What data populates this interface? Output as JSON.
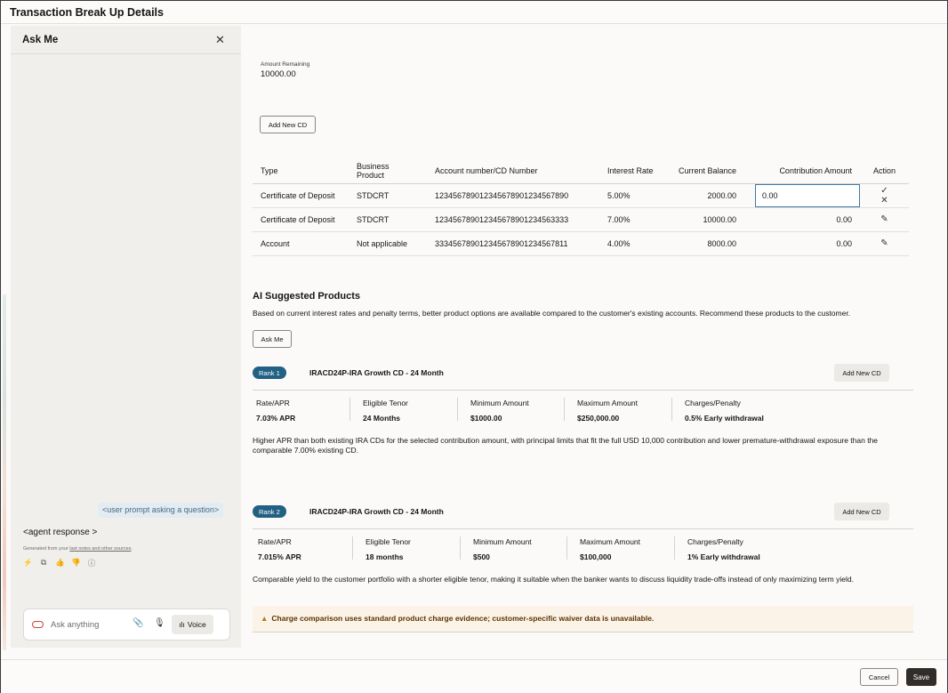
{
  "window": {
    "title": "Transaction Break Up Details"
  },
  "ask_panel": {
    "title": "Ask Me",
    "user_prompt": "<user prompt asking a question>",
    "agent_response": "<agent response >",
    "generated_prefix": "Generated from your ",
    "generated_link": "last notes and other sources",
    "generated_suffix": ".",
    "input_placeholder": "Ask anything",
    "voice_label": "Voice"
  },
  "amount": {
    "label": "Amount Remaining",
    "value": "10000.00"
  },
  "add_new_cd_label": "Add New CD",
  "table": {
    "headers": [
      "Type",
      "Business Product",
      "Account number/CD Number",
      "Interest Rate",
      "Current Balance",
      "Contribution Amount",
      "Action"
    ],
    "rows": [
      {
        "type": "Certificate of Deposit",
        "product": "STDCRT",
        "account": "123456789012345678901234567890",
        "rate": "5.00%",
        "balance": "2000.00",
        "contribution": "0.00",
        "editing": true
      },
      {
        "type": "Certificate of Deposit",
        "product": "STDCRT",
        "account": "123456789012345678901234563333",
        "rate": "7.00%",
        "balance": "10000.00",
        "contribution": "0.00",
        "editing": false
      },
      {
        "type": "Account",
        "product": "Not applicable",
        "account": "333456789012345678901234567811",
        "rate": "4.00%",
        "balance": "8000.00",
        "contribution": "0.00",
        "editing": false
      }
    ]
  },
  "ai": {
    "title": "AI Suggested Products",
    "description": "Based on current interest rates and penalty terms, better product options are available compared to the customer's existing accounts. Recommend these products to the customer.",
    "ask_me_label": "Ask Me",
    "products": [
      {
        "rank": "Rank 1",
        "name": "IRACD24P-IRA Growth CD - 24 Month",
        "add_label": "Add New CD",
        "metrics": [
          {
            "label": "Rate/APR",
            "value": "7.03% APR"
          },
          {
            "label": "Eligible Tenor",
            "value": "24 Months"
          },
          {
            "label": "Minimum Amount",
            "value": "$1000.00"
          },
          {
            "label": "Maximum Amount",
            "value": "$250,000.00"
          },
          {
            "label": "Charges/Penalty",
            "value": "0.5% Early withdrawal"
          }
        ],
        "description": "Higher APR than both existing IRA CDs for the selected contribution amount, with principal limits that fit the full USD 10,000 contribution and lower premature-withdrawal exposure than the comparable 7.00% existing CD."
      },
      {
        "rank": "Rank 2",
        "name": "IRACD24P-IRA Growth CD - 24 Month",
        "add_label": "Add New CD",
        "metrics": [
          {
            "label": "Rate/APR",
            "value": "7.015% APR"
          },
          {
            "label": "Eligible Tenor",
            "value": "18 months"
          },
          {
            "label": "Minimum Amount",
            "value": "$500"
          },
          {
            "label": "Maximum Amount",
            "value": "$100,000"
          },
          {
            "label": "Charges/Penalty",
            "value": "1% Early withdrawal"
          }
        ],
        "description": "Comparable yield to the customer portfolio with a shorter eligible tenor, making it suitable when the banker wants to discuss liquidity trade-offs instead of only maximizing term yield."
      }
    ],
    "warning": "Charge comparison uses standard product charge evidence; customer-specific waiver data is unavailable."
  },
  "footer": {
    "cancel_label": "Cancel",
    "save_label": "Save"
  },
  "colors": {
    "rank_badge": "#226184",
    "save_button": "#312d2a",
    "focus_border": "#3d7aa9",
    "oracle_accent": "#c74634"
  }
}
